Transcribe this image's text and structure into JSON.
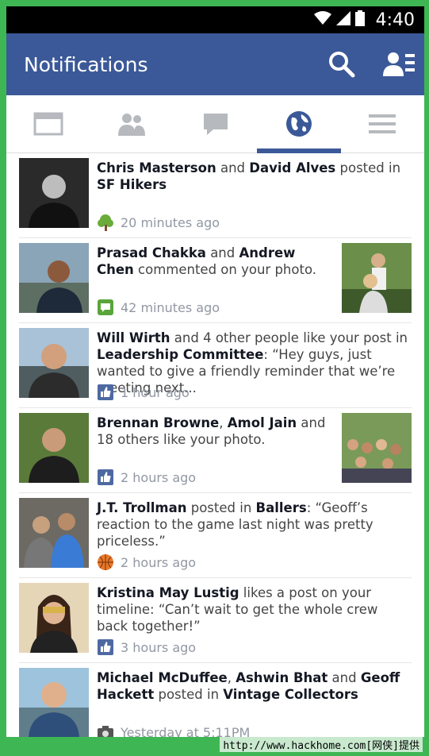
{
  "status": {
    "time": "4:40"
  },
  "appbar": {
    "title": "Notifications",
    "colors": {
      "brand": "#3b5998"
    }
  },
  "tabs": [
    "news-feed-icon",
    "friend-requests-icon",
    "messages-icon",
    "notifications-globe-icon",
    "more-menu-icon"
  ],
  "notifications": [
    {
      "parts": [
        {
          "b": "Chris Masterson"
        },
        {
          "t": " and "
        },
        {
          "b": "David Alves"
        },
        {
          "t": " posted in "
        },
        {
          "b": "SF Hikers"
        }
      ],
      "time": "20 minutes ago",
      "icon": "tree-icon"
    },
    {
      "parts": [
        {
          "b": "Prasad Chakka"
        },
        {
          "t": " and "
        },
        {
          "b": "Andrew Chen"
        },
        {
          "t": " commented on your photo."
        }
      ],
      "time": "42 minutes ago",
      "icon": "comment-icon"
    },
    {
      "parts": [
        {
          "b": "Will Wirth"
        },
        {
          "t": " and 4 other people like your post in "
        },
        {
          "b": "Leadership Committee"
        },
        {
          "t": ": “Hey guys, just wanted to give a friendly reminder that we’re meeting next..."
        }
      ],
      "time": "1 hour ago",
      "icon": "like-icon"
    },
    {
      "parts": [
        {
          "b": "Brennan Browne"
        },
        {
          "t": ", "
        },
        {
          "b": "Amol Jain"
        },
        {
          "t": " and 18 others like your photo."
        }
      ],
      "time": "2 hours ago",
      "icon": "like-icon"
    },
    {
      "parts": [
        {
          "b": "J.T. Trollman"
        },
        {
          "t": " posted in "
        },
        {
          "b": "Ballers"
        },
        {
          "t": ": “Geoff’s reaction to the game last night was pretty priceless.”"
        }
      ],
      "time": "2 hours ago",
      "icon": "basketball-icon"
    },
    {
      "parts": [
        {
          "b": "Kristina May Lustig"
        },
        {
          "t": " likes a post on your timeline: “Can’t wait to get the whole crew back together!”"
        }
      ],
      "time": "3 hours ago",
      "icon": "like-icon"
    },
    {
      "parts": [
        {
          "b": "Michael McDuffee"
        },
        {
          "t": ", "
        },
        {
          "b": "Ashwin Bhat"
        },
        {
          "t": " and "
        },
        {
          "b": "Geoff Hackett"
        },
        {
          "t": " posted in "
        },
        {
          "b": "Vintage Collectors"
        }
      ],
      "time": "Yesterday at 5:11PM",
      "icon": "camera-icon"
    }
  ],
  "watermark": "http://www.hackhome.com[网侠]提供"
}
